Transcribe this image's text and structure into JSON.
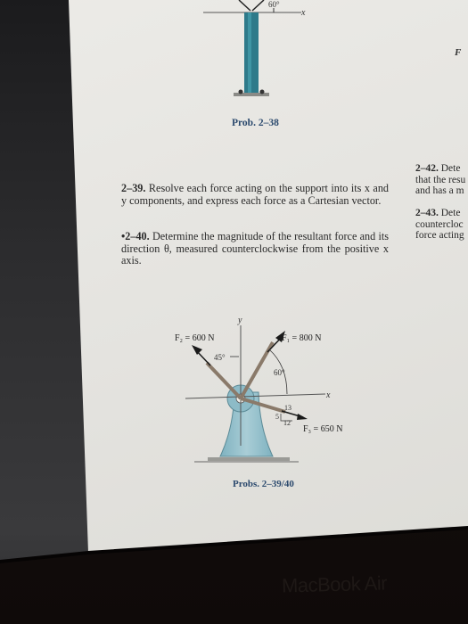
{
  "device": {
    "brand_label": "MacBook Air"
  },
  "top_figure": {
    "caption": "Prob. 2–38",
    "angle_label": "60°",
    "x_axis_label": "x",
    "force_label_partial": "F"
  },
  "problems": [
    {
      "number": "2–39.",
      "text": "Resolve each force acting on the support into its x and y components, and express each force as a Cartesian vector."
    },
    {
      "number": "•2–40.",
      "text": "Determine the magnitude of the resultant force and its direction θ, measured counterclockwise from the positive x axis."
    }
  ],
  "side_column": [
    {
      "number": "2–42.",
      "lines": [
        "Dete",
        "that the resu",
        "and has a m"
      ]
    },
    {
      "number": "2–43.",
      "lines": [
        "Dete",
        "countercloc",
        "force acting"
      ]
    }
  ],
  "main_figure": {
    "caption": "Probs. 2–39/40",
    "y_axis_label": "y",
    "x_axis_label": "x",
    "forces": [
      {
        "label": "F₁ = 800 N",
        "angle_label": "60°"
      },
      {
        "label": "F₂ = 600 N",
        "angle_label": "45°"
      },
      {
        "label": "F₃ = 650 N",
        "slope_labels": [
          "13",
          "5",
          "12"
        ]
      }
    ]
  }
}
